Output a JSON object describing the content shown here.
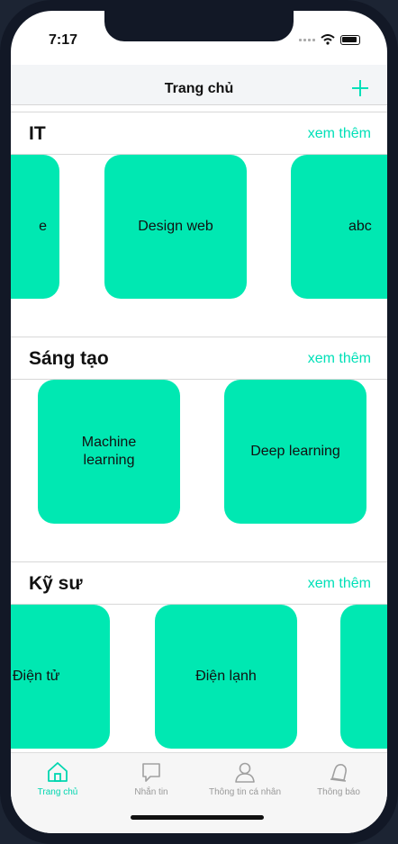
{
  "status_bar": {
    "time": "7:17"
  },
  "navbar": {
    "title": "Trang chủ"
  },
  "sections": [
    {
      "title": "IT",
      "see_more": "xem thêm",
      "cards": [
        "e",
        "Design web",
        "abc"
      ]
    },
    {
      "title": "Sáng tạo",
      "see_more": "xem thêm",
      "cards": [
        "Machine learning",
        "Deep learning"
      ]
    },
    {
      "title": "Kỹ sư",
      "see_more": "xem thêm",
      "cards": [
        "Điện tử",
        "Điện lạnh",
        ""
      ]
    }
  ],
  "tabbar": {
    "items": [
      {
        "label": "Trang chủ",
        "icon": "home-icon",
        "active": true
      },
      {
        "label": "Nhắn tin",
        "icon": "chat-icon",
        "active": false
      },
      {
        "label": "Thông tin cá nhân",
        "icon": "user-icon",
        "active": false
      },
      {
        "label": "Thông báo",
        "icon": "bell-icon",
        "active": false
      }
    ]
  },
  "colors": {
    "accent": "#00e0b8",
    "card": "#00e8b2"
  }
}
